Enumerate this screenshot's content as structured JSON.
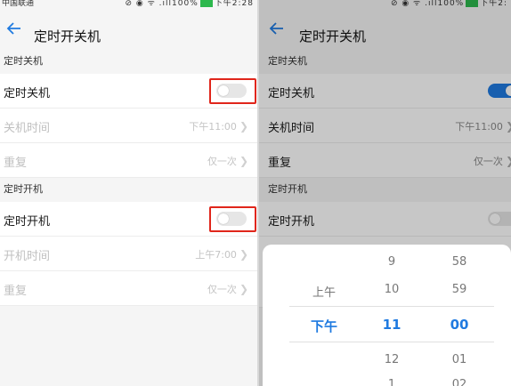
{
  "left": {
    "status": {
      "carrier": "中国联通",
      "icons": "⊘ ◉ ᯤ .ıll100%",
      "time": "下午2:28"
    },
    "header": {
      "title": "定时开关机"
    },
    "shutdown": {
      "section": "定时关机",
      "toggle_label": "定时关机",
      "toggle_on": false,
      "time_label": "关机时间",
      "time_value": "下午11:00",
      "repeat_label": "重复",
      "repeat_value": "仅一次"
    },
    "startup": {
      "section": "定时开机",
      "toggle_label": "定时开机",
      "toggle_on": false,
      "time_label": "开机时间",
      "time_value": "上午7:00",
      "repeat_label": "重复",
      "repeat_value": "仅一次"
    }
  },
  "right": {
    "status": {
      "icons": "⊘ ◉ ᯤ .ıll100%",
      "time": "下午2:"
    },
    "header": {
      "title": "定时开关机"
    },
    "shutdown": {
      "section": "定时关机",
      "toggle_label": "定时关机",
      "toggle_on": true,
      "time_label": "关机时间",
      "time_value": "下午11:00",
      "repeat_label": "重复",
      "repeat_value": "仅一次"
    },
    "startup": {
      "section": "定时开机",
      "toggle_label": "定时开机",
      "toggle_on": false
    },
    "picker": {
      "ampm": {
        "above": "上午",
        "selected": "下午"
      },
      "hours": {
        "above2": "9",
        "above1": "10",
        "selected": "11",
        "below1": "12",
        "below2": "1"
      },
      "minutes": {
        "above2": "58",
        "above1": "59",
        "selected": "00",
        "below1": "01",
        "below2": "02"
      }
    }
  },
  "colors": {
    "accent": "#1f7ae0",
    "highlight": "#e0261b"
  },
  "icons": {
    "back": "back-arrow-icon",
    "chevron": "chevron-right-icon"
  }
}
